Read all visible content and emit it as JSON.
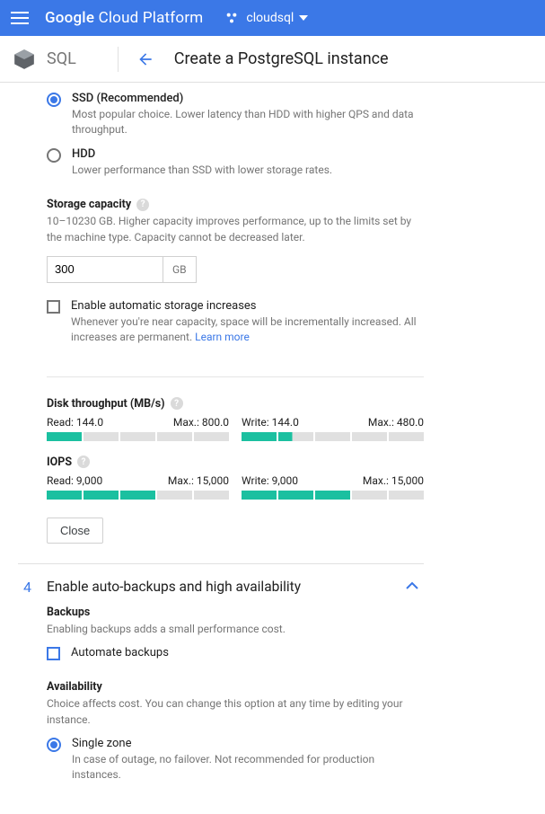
{
  "header": {
    "brand_bold": "Google",
    "brand_rest": " Cloud Platform",
    "project": "cloudsql"
  },
  "subheader": {
    "product": "SQL",
    "title": "Create a PostgreSQL instance"
  },
  "storage_type": {
    "ssd_label": "SSD (Recommended)",
    "ssd_desc": "Most popular choice. Lower latency than HDD with higher QPS and data throughput.",
    "hdd_label": "HDD",
    "hdd_desc": "Lower performance than SSD with lower storage rates."
  },
  "capacity": {
    "label": "Storage capacity",
    "desc": "10–10230 GB. Higher capacity improves performance, up to the limits set by the machine type. Capacity cannot be decreased later.",
    "value": "300",
    "unit": "GB"
  },
  "auto_increase": {
    "label": "Enable automatic storage increases",
    "desc_prefix": "Whenever you're near capacity, space will be incrementally increased. All increases are permanent. ",
    "learn_more": "Learn more"
  },
  "throughput": {
    "label": "Disk throughput (MB/s)",
    "read_label": "Read: 144.0",
    "read_max": "Max.: 800.0",
    "write_label": "Write: 144.0",
    "write_max": "Max.: 480.0"
  },
  "iops": {
    "label": "IOPS",
    "read_label": "Read: 9,000",
    "read_max": "Max.: 15,000",
    "write_label": "Write: 9,000",
    "write_max": "Max.: 15,000"
  },
  "close_btn": "Close",
  "step4": {
    "number": "4",
    "title": "Enable auto-backups and high availability",
    "backups_label": "Backups",
    "backups_desc": "Enabling backups adds a small performance cost.",
    "automate_label": "Automate backups",
    "avail_label": "Availability",
    "avail_desc": "Choice affects cost. You can change this option at any time by editing your instance.",
    "single_label": "Single zone",
    "single_desc": "In case of outage, no failover. Not recommended for production instances."
  }
}
